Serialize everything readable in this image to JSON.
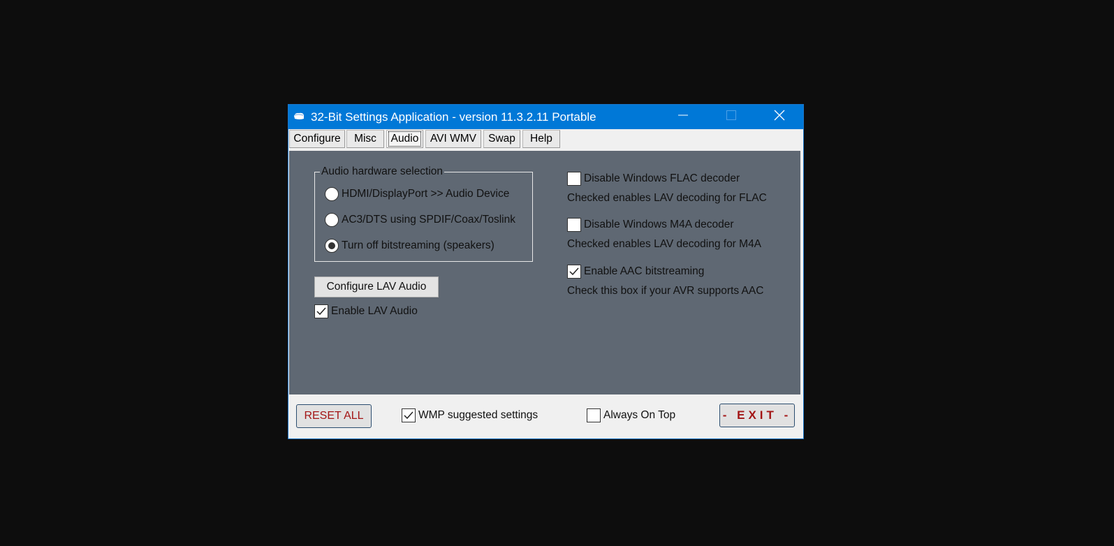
{
  "window": {
    "title": "32-Bit Settings Application - version 11.3.2.11 Portable",
    "app_icon": "app-cloud-icon",
    "controls": {
      "minimize_icon": "minimize-icon",
      "maximize_icon": "maximize-icon",
      "close_icon": "close-icon"
    }
  },
  "tabs": [
    {
      "label": "Configure",
      "active": false
    },
    {
      "label": "Misc",
      "active": false
    },
    {
      "label": "Audio",
      "active": true
    },
    {
      "label": "AVI WMV",
      "active": false
    },
    {
      "label": "Swap",
      "active": false
    },
    {
      "label": "Help",
      "active": false
    }
  ],
  "audio": {
    "hardware_group": {
      "legend": "Audio hardware selection",
      "options": [
        {
          "label": "HDMI/DisplayPort >> Audio Device",
          "selected": false
        },
        {
          "label": "AC3/DTS using SPDIF/Coax/Toslink",
          "selected": false
        },
        {
          "label": "Turn off bitstreaming (speakers)",
          "selected": true
        }
      ]
    },
    "configure_lav_button": "Configure LAV Audio",
    "enable_lav_audio": {
      "label": "Enable LAV Audio",
      "checked": true
    },
    "right_options": [
      {
        "label": "Disable Windows FLAC decoder",
        "checked": false,
        "description": "Checked enables LAV decoding for FLAC"
      },
      {
        "label": "Disable Windows M4A decoder",
        "checked": false,
        "description": "Checked enables LAV decoding for M4A"
      },
      {
        "label": "Enable AAC bitstreaming",
        "checked": true,
        "description": "Check this box if your AVR supports AAC"
      }
    ]
  },
  "footer": {
    "reset_label": "RESET ALL",
    "wmp_suggested": {
      "label": "WMP suggested settings",
      "checked": true
    },
    "always_on_top": {
      "label": "Always On Top",
      "checked": false
    },
    "exit_label": "- EXIT -"
  },
  "colors": {
    "titlebar": "#0078d7",
    "panel": "#5f6873",
    "footer_button_text": "#a31515"
  }
}
